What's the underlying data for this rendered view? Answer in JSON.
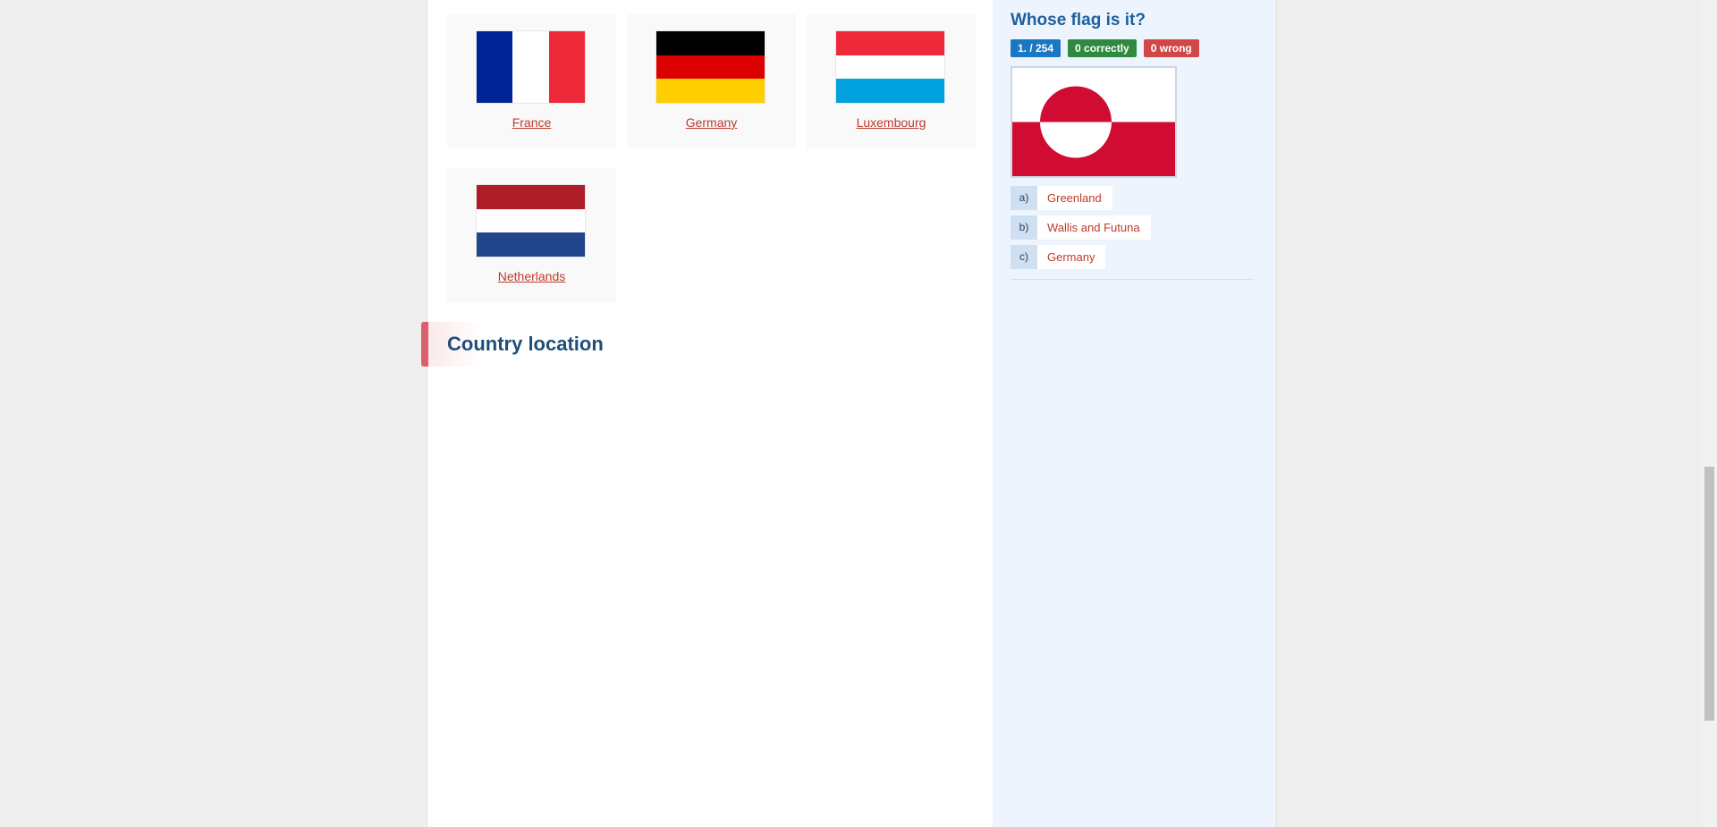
{
  "flags": [
    {
      "country": "France"
    },
    {
      "country": "Germany"
    },
    {
      "country": "Luxembourg"
    },
    {
      "country": "Netherlands"
    }
  ],
  "section": {
    "title": "Country location"
  },
  "quiz": {
    "title": "Whose flag is it?",
    "progress": "1. / 254",
    "correct": "0  correctly",
    "wrong": "0  wrong",
    "answers": [
      {
        "letter": "a)",
        "text": "Greenland"
      },
      {
        "letter": "b)",
        "text": "Wallis and Futuna"
      },
      {
        "letter": "c)",
        "text": "Germany"
      }
    ]
  },
  "colors": {
    "link": "#c0392b",
    "heading": "#1f4e79",
    "badge_blue": "#1a77c2",
    "badge_green": "#2f8a3f",
    "badge_red": "#d14747",
    "france": [
      "#002395",
      "#ffffff",
      "#ed2939"
    ],
    "germany": [
      "#000000",
      "#dd0000",
      "#ffce00"
    ],
    "luxembourg": [
      "#ed2939",
      "#ffffff",
      "#00a1de"
    ],
    "netherlands": [
      "#ae1c28",
      "#ffffff",
      "#21468b"
    ],
    "greenland": [
      "#ffffff",
      "#d00c33"
    ]
  },
  "scrollbar": {
    "position": 0.79
  }
}
